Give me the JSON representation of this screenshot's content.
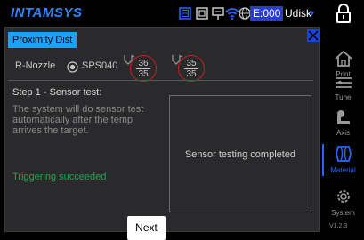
{
  "header": {
    "brand": "INTAMSYS",
    "icons": [
      "image-icon",
      "camera-icon",
      "network-port-icon",
      "wifi-icon",
      "globe-icon"
    ],
    "error_code": "E:000",
    "storage": "Udisk",
    "lock_icon": "lock-icon"
  },
  "sidebar": {
    "items": [
      {
        "label": "Print",
        "icon": "home-icon"
      },
      {
        "label": "Tune",
        "icon": "sliders-icon"
      },
      {
        "label": "Axis",
        "icon": "axis-icon"
      },
      {
        "label": "Material",
        "icon": "spool-icon",
        "active": true
      },
      {
        "label": "System",
        "icon": "gear-icon"
      }
    ],
    "version": "V1.2.3"
  },
  "dialog": {
    "tab_title": "Proximity Dist",
    "nozzle_label": "R-Nozzle",
    "sensor_name": "SPS040",
    "temps": [
      {
        "current": "36",
        "target": "35"
      },
      {
        "current": "35",
        "target": "35"
      }
    ],
    "step_title": "Step 1 - Sensor test:",
    "step_description": "The system will do sensor test automatically after the temp arrives the target.",
    "trigger_status": "Triggering succeeded",
    "result_text": "Sensor testing completed",
    "next_label": "Next"
  },
  "colors": {
    "accent_blue": "#2b63ff",
    "tab_blue": "#1fa0f0",
    "success_green": "#1fa54a",
    "alert_red": "#c92020",
    "panel_bg": "#2a2a2c"
  }
}
